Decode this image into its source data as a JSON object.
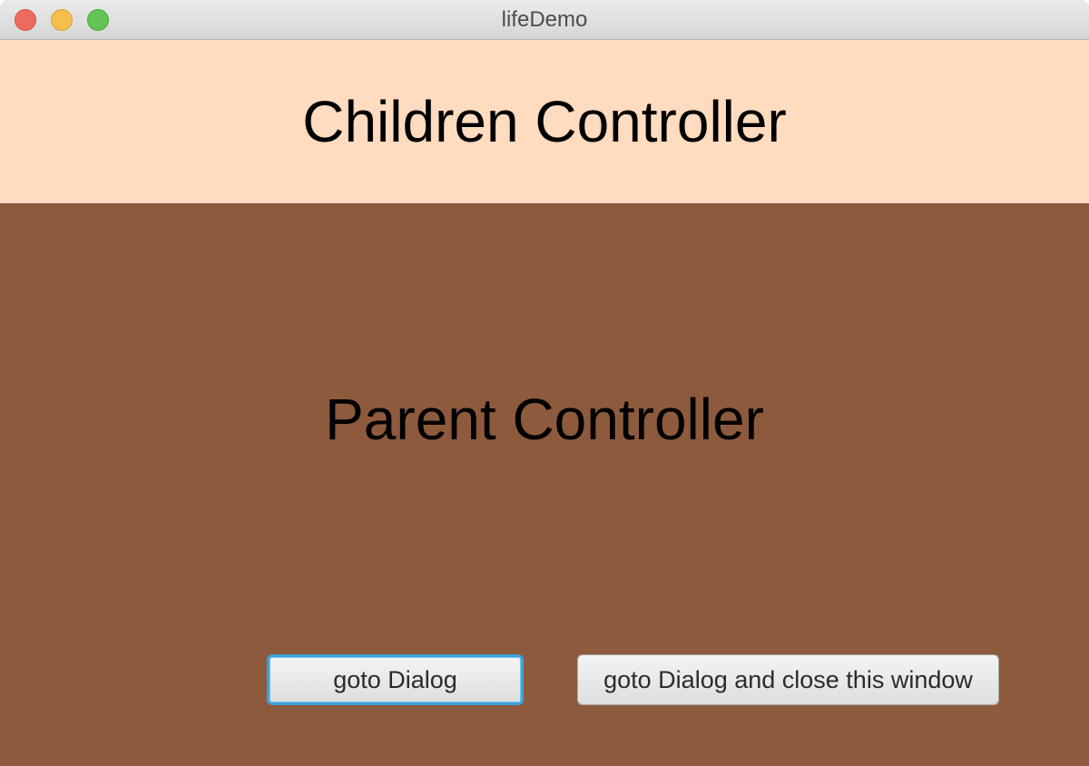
{
  "window": {
    "title": "lifeDemo"
  },
  "child_pane": {
    "heading": "Children Controller",
    "background": "#ffdbbf"
  },
  "parent_pane": {
    "heading": "Parent Controller",
    "background": "#8e5a3d",
    "buttons": {
      "goto_dialog": "goto Dialog",
      "goto_dialog_close": "goto Dialog and close this window"
    }
  },
  "colors": {
    "focus_ring": "#3aa3dc",
    "close": "#ed6a5e",
    "minimize": "#f5bf4f",
    "maximize": "#61c454"
  }
}
